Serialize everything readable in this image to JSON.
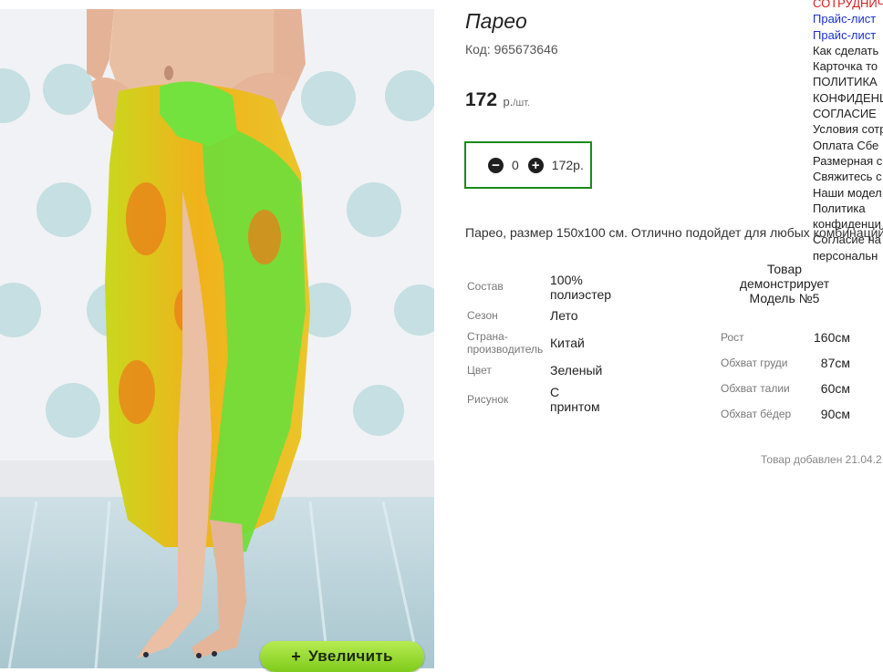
{
  "product": {
    "title": "Парео",
    "code": "Код: 965673646",
    "price_value": "172",
    "price_currency": "р.",
    "price_unit": "/шт.",
    "zoom_button": "Увеличить",
    "zoom_plus": "+",
    "quantity": "0",
    "total": "172р.",
    "description": "Парео, размер 150х100 см. Отлично подойдет для любых комбинаций"
  },
  "attributes": [
    {
      "label": "Состав",
      "value": "100% полиэстер"
    },
    {
      "label": "Сезон",
      "value": "Лето"
    },
    {
      "label": "Страна-производитель",
      "value": "Китай"
    },
    {
      "label": "Цвет",
      "value": "Зеленый"
    },
    {
      "label": "Рисунок",
      "value": "С принтом"
    }
  ],
  "model": {
    "title": "Товар демонстрирует Модель №5",
    "params": [
      {
        "label": "Рост",
        "value": "160см"
      },
      {
        "label": "Обхват груди",
        "value": "87см"
      },
      {
        "label": "Обхват талии",
        "value": "60см"
      },
      {
        "label": "Обхват бёдер",
        "value": "90см"
      }
    ]
  },
  "added_text": "Товар добавлен 21.04.2",
  "side_links": [
    "СОТРУДНИЧ",
    "Прайс-лист",
    "Прайс-лист",
    "Как сделать",
    "Карточка то",
    "ПОЛИТИКА",
    "КОНФИДЕНЦ",
    "СОГЛАСИЕ",
    "Условия сотр",
    "Оплата Сбе",
    "Размерная с",
    "Свяжитесь с",
    "Наши модел",
    "Политика",
    "конфиденци",
    "Согласие на",
    "персональн"
  ],
  "colors": {
    "qty_border": "#1a8a1a",
    "zoom_button": "#8fd62a",
    "link_red": "#d42020",
    "link_blue": "#1d2fd0"
  }
}
